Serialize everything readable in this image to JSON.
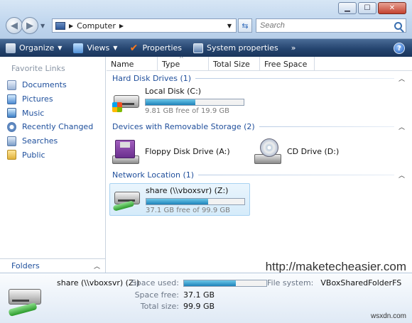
{
  "window": {
    "minimize_glyph": "▁",
    "maximize_glyph": "☐",
    "close_glyph": "✕"
  },
  "address": {
    "path": "Computer",
    "search_placeholder": "Search"
  },
  "toolbar": {
    "organize": "Organize",
    "views": "Views",
    "properties": "Properties",
    "system_properties": "System properties",
    "more": "»",
    "help": "?"
  },
  "left_pane": {
    "heading": "Favorite Links",
    "items": [
      {
        "label": "Documents",
        "icon": "documents-icon"
      },
      {
        "label": "Pictures",
        "icon": "pictures-icon"
      },
      {
        "label": "Music",
        "icon": "music-icon"
      },
      {
        "label": "Recently Changed",
        "icon": "recently-changed-icon"
      },
      {
        "label": "Searches",
        "icon": "searches-icon"
      },
      {
        "label": "Public",
        "icon": "public-icon"
      }
    ],
    "folders": "Folders"
  },
  "columns": [
    "Name",
    "Type",
    "Total Size",
    "Free Space"
  ],
  "groups": {
    "hdd": "Hard Disk Drives (1)",
    "removable": "Devices with Removable Storage (2)",
    "network": "Network Location (1)"
  },
  "drives": {
    "local": {
      "name": "Local Disk (C:)",
      "free": "9.81 GB free of 19.9 GB",
      "used_fraction": 0.507
    },
    "floppy": {
      "name": "Floppy Disk Drive (A:)"
    },
    "cd": {
      "name": "CD Drive (D:)"
    },
    "share": {
      "name": "share (\\\\vboxsvr) (Z:)",
      "free": "37.1 GB free of 99.9 GB",
      "used_fraction": 0.629
    }
  },
  "watermark": "http://maketecheasier.com",
  "details": {
    "title": "share (\\\\vboxsvr) (Z:)",
    "space_used_label": "Space used:",
    "used_fraction": 0.629,
    "space_free_label": "Space free:",
    "space_free": "37.1 GB",
    "total_size_label": "Total size:",
    "total_size": "99.9 GB",
    "fs_label": "File system:",
    "fs_value": "VBoxSharedFolderFS"
  },
  "credit": "wsxdn.com",
  "colors": {
    "toolbar": "#25446f",
    "link": "#1e4f9c",
    "bar_fill": "#1d82b9"
  }
}
